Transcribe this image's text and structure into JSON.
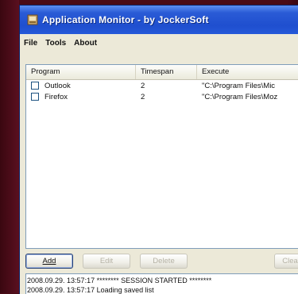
{
  "window": {
    "title": "Application Monitor - by JockerSoft"
  },
  "menu": {
    "items": [
      "File",
      "Tools",
      "About"
    ]
  },
  "list": {
    "columns": [
      "Program",
      "Timespan",
      "Execute"
    ],
    "rows": [
      {
        "program": "Outlook",
        "timespan": "2",
        "execute": "\"C:\\Program Files\\Mic"
      },
      {
        "program": "Firefox",
        "timespan": "2",
        "execute": "\"C:\\Program Files\\Moz"
      }
    ]
  },
  "buttons": {
    "add": "Add",
    "edit": "Edit",
    "delete": "Delete",
    "clear": "Clea"
  },
  "log": {
    "lines": [
      "2008.09.29. 13:57:17   ******** SESSION STARTED ********",
      "2008.09.29. 13:57:17   Loading saved list"
    ]
  },
  "colors": {
    "titlebar": "#2a5bd6",
    "background": "#4a0b16",
    "window": "#ece9d8"
  },
  "icons": {
    "app": "application-monitor-icon"
  }
}
